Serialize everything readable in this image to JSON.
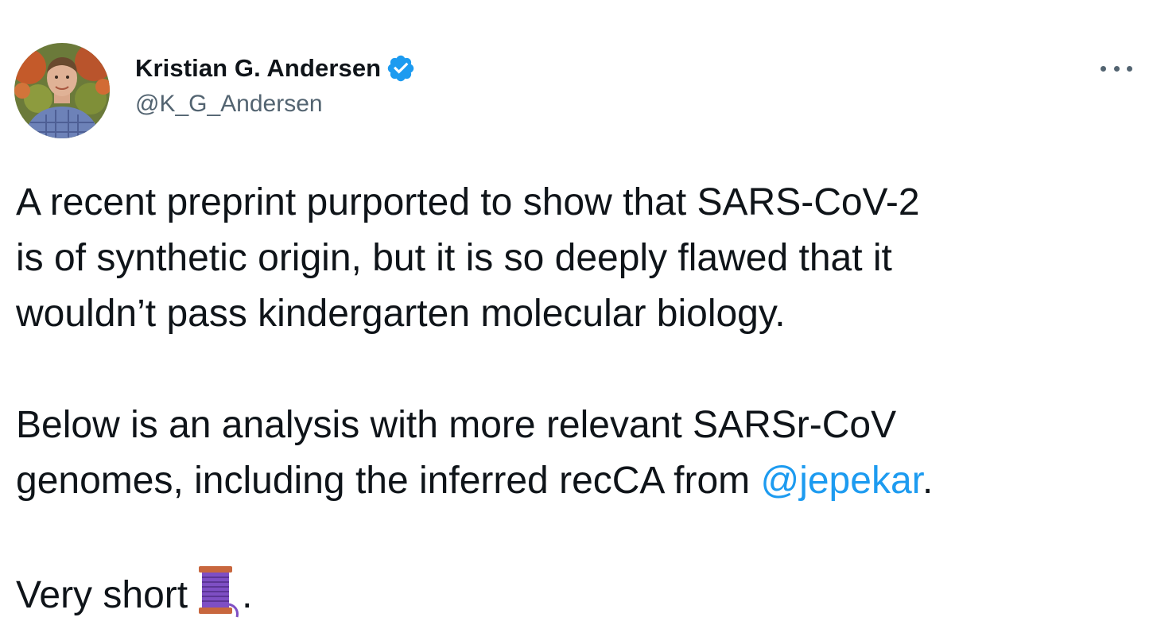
{
  "author": {
    "display_name": "Kristian G. Andersen",
    "handle": "@K_G_Andersen",
    "verified": true,
    "avatar_icon": "profile-photo"
  },
  "menu": {
    "icon": "more-options-icon"
  },
  "tweet": {
    "paragraph1": [
      "A recent preprint purported to show that SARS-CoV-2",
      "is of synthetic origin, but it is so deeply flawed that it",
      "wouldn’t pass kindergarten molecular biology."
    ],
    "paragraph2": {
      "line1": "Below is an analysis with more relevant SARSr-CoV",
      "line2_prefix": "genomes, including the inferred recCA from ",
      "mention": "@jepekar",
      "line2_suffix": "."
    },
    "paragraph3": {
      "text": "Very short",
      "emoji": "thread-spool-emoji",
      "suffix": "."
    }
  },
  "colors": {
    "text": "#0f1419",
    "secondary": "#536471",
    "link": "#1d9bf0",
    "verified_badge": "#1d9bf0",
    "spool": "#7e4fc4"
  }
}
